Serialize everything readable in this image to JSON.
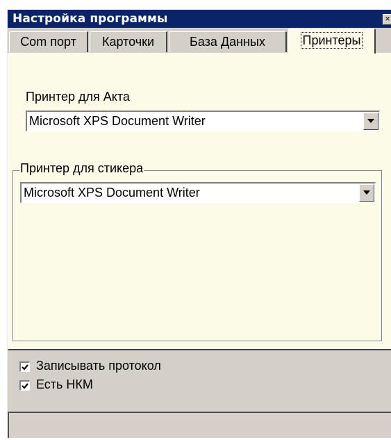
{
  "window": {
    "title": "Настройка программы",
    "close_glyph": "×"
  },
  "tabs": [
    {
      "label": "Com порт",
      "active": false
    },
    {
      "label": "Карточки",
      "active": false
    },
    {
      "label": "База Данных",
      "active": false
    },
    {
      "label": "Принтеры",
      "active": true
    }
  ],
  "printers": {
    "act_label": "Принтер для Акта",
    "act_value": "Microsoft XPS Document Writer",
    "sticker_group_label": "Принтер для стикера",
    "sticker_value": "Microsoft XPS Document Writer"
  },
  "options": {
    "log_protocol_label": "Записывать протокол",
    "log_protocol_checked": true,
    "has_nkm_label": "Есть НКМ",
    "has_nkm_checked": true
  },
  "statusbar": {
    "text": ""
  },
  "colors": {
    "titlebar": "#0a246a",
    "panel_background": "#fbfbe8",
    "window_background": "#d4d0c8"
  },
  "icons": {
    "close": "close-icon",
    "dropdown": "chevron-down-icon",
    "checkmark": "check-icon"
  }
}
